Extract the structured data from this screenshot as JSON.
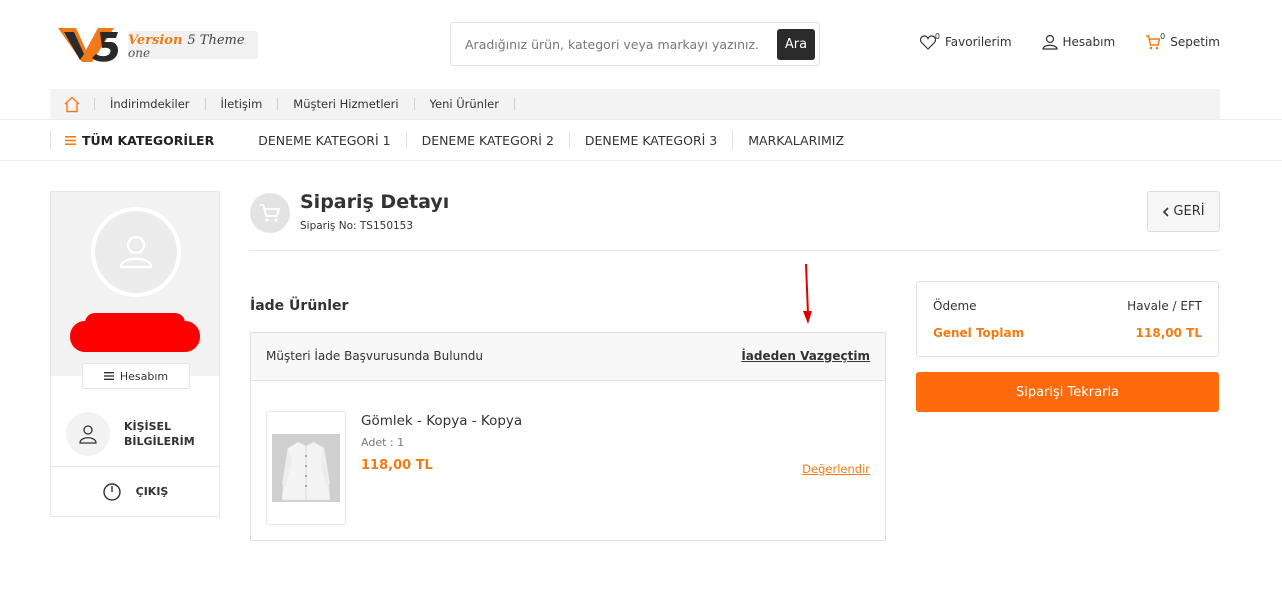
{
  "brand": {
    "logo_word1": "Version",
    "logo_word2": "5 Theme",
    "logo_word3": "one",
    "accent": "#ff6a0c"
  },
  "search": {
    "placeholder": "Aradığınız ürün, kategori veya markayı yazınız.",
    "button_label": "Ara",
    "icon": "search"
  },
  "header_links": {
    "favorites": {
      "label": "Favorilerim",
      "count": "0",
      "icon": "heart-icon"
    },
    "account": {
      "label": "Hesabım",
      "icon": "user-icon"
    },
    "cart": {
      "label": "Sepetim",
      "count": "0",
      "icon": "cart-icon"
    }
  },
  "top_nav": {
    "home_icon": "home-icon",
    "items": [
      "İndirimdekiler",
      "İletişim",
      "Müşteri Hizmetleri",
      "Yeni Ürünler"
    ]
  },
  "category_nav": {
    "all_label": "TÜM KATEGORİLER",
    "items": [
      "DENEME KATEGORİ 1",
      "DENEME KATEGORİ 2",
      "DENEME KATEGORİ 3",
      "MARKALARIMIZ"
    ]
  },
  "sidebar": {
    "account_button": "Hesabım",
    "personal_info": "KİŞİSEL BİLGİLERİM",
    "logout": "ÇIKIŞ"
  },
  "order": {
    "title": "Sipariş Detayı",
    "number_text": "Sipariş No: TS150153",
    "back_label": "GERİ"
  },
  "returns": {
    "section_title": "İade Ürünler",
    "status_text": "Müşteri İade Başvurusunda Bulundu",
    "cancel_label": "İadeden Vazgeçtim",
    "product": {
      "name": "Gömlek - Kopya - Kopya",
      "qty_text": "Adet : 1",
      "price": "118,00 TL",
      "rate_label": "Değerlendir"
    }
  },
  "summary": {
    "payment_label": "Ödeme",
    "payment_value": "Havale / EFT",
    "total_label": "Genel Toplam",
    "total_value": "118,00 TL",
    "repeat_button": "Siparişi Tekrarla"
  }
}
